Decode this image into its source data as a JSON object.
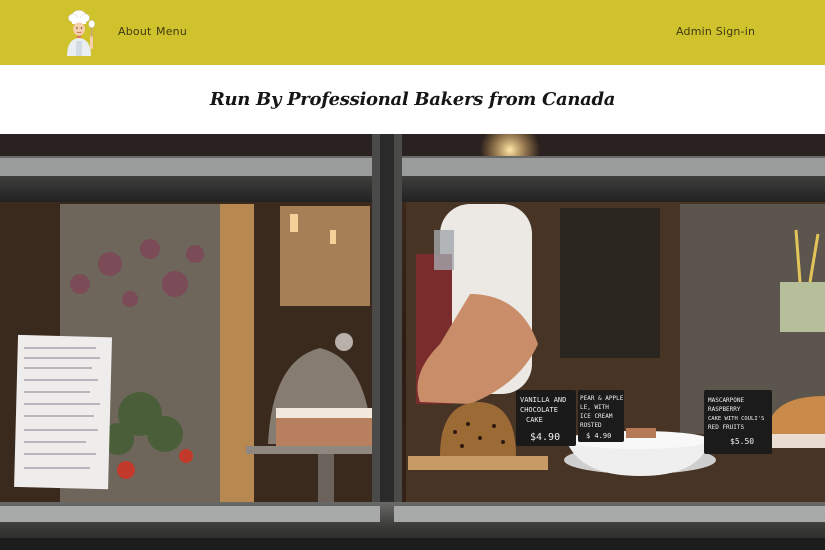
{
  "navbar": {
    "logo_icon": "baker-chef-icon",
    "links": [
      {
        "label": "About"
      },
      {
        "label": "Menu"
      }
    ],
    "admin_label": "Admin Sign-in",
    "background_color": "#cfc22c"
  },
  "hero": {
    "tagline": "Run By Professional Bakers from Canada",
    "image_icon": "bakery-window-photo",
    "chalkboards": [
      {
        "lines": [
          "VANILLA AND",
          "CHOCOLATE",
          "CAKE",
          "$4.90"
        ]
      },
      {
        "lines": [
          "PEAR & APPLE",
          "LE, WITH",
          "ICE CREAM",
          "ROSTED",
          "$ 4.90"
        ]
      },
      {
        "lines": [
          "MASCARPONE",
          "RASPBERRY",
          "CAKE WITH COULI'S",
          "RED FRUITS",
          "$5.50"
        ]
      }
    ]
  }
}
